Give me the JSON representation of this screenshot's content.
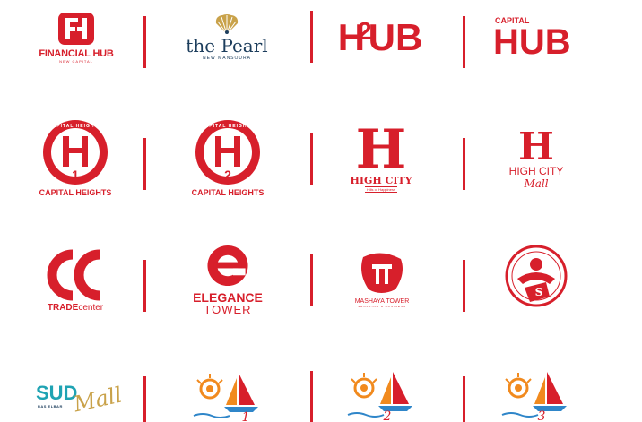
{
  "colors": {
    "brand_red": "#d71f2b",
    "navy": "#1c3d5c",
    "teal": "#1fa3b3",
    "gold": "#c9a24a",
    "orange": "#f18a1e",
    "sea_blue": "#2f86c9"
  },
  "logos": [
    {
      "name": "FINANCIAL HUB",
      "sub": "NEW CAPITAL",
      "monogram": "FH"
    },
    {
      "name": "the Pearl",
      "sub": "NEW MANSOURA"
    },
    {
      "name": "H",
      "accent": "2",
      "tail": "UB"
    },
    {
      "top": "CAPITAL",
      "name": "HUB"
    },
    {
      "ring_text": "CAPITAL HEIGHTS",
      "monogram": "H",
      "number": "1",
      "name": "CAPITAL HEIGHTS"
    },
    {
      "ring_text": "CAPITAL HEIGHTS",
      "monogram": "H",
      "number": "2",
      "name": "CAPITAL HEIGHTS"
    },
    {
      "monogram": "H",
      "name": "HIGH CITY",
      "sub": "Hills of Happiness"
    },
    {
      "monogram": "H",
      "name": "HIGH CITY",
      "sub": "Mall"
    },
    {
      "name_bold": "TRADE",
      "name_light": "center"
    },
    {
      "name": "ELEGANCE",
      "sub": "TOWER"
    },
    {
      "name": "MASHAYA TOWER",
      "sub": "SHOPPING & BUSINESS"
    },
    {
      "monogram": "S"
    },
    {
      "name": "SUD",
      "script": "Mall",
      "sub": "RAS ELBAR"
    },
    {
      "script": "1"
    },
    {
      "script": "2"
    },
    {
      "script": "3"
    }
  ]
}
